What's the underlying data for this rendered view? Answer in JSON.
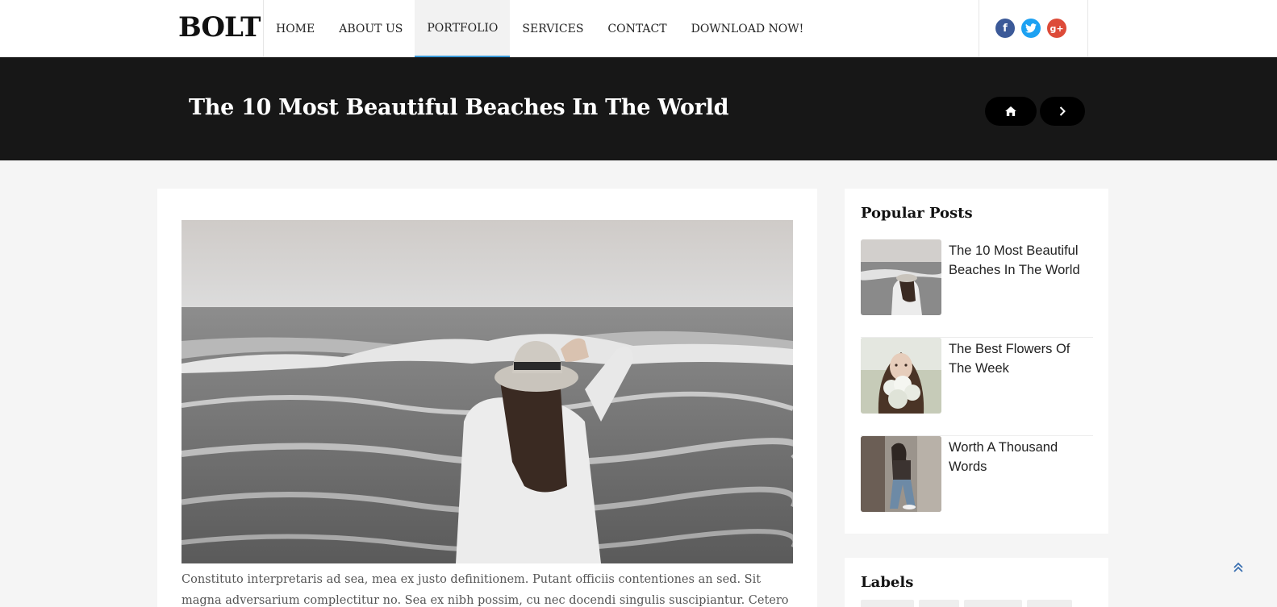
{
  "header": {
    "logo": "BOLT",
    "nav": [
      {
        "label": "HOME",
        "active": false
      },
      {
        "label": "ABOUT US",
        "active": false
      },
      {
        "label": "PORTFOLIO",
        "active": true
      },
      {
        "label": "SERVICES",
        "active": false
      },
      {
        "label": "CONTACT",
        "active": false
      },
      {
        "label": "DOWNLOAD NOW!",
        "active": false
      }
    ],
    "social": {
      "facebook_icon": "f",
      "twitter_icon": "twitter-bird",
      "google_plus_icon": "g+"
    }
  },
  "band": {
    "title": "The 10 Most Beautiful Beaches In The World",
    "home_icon": "home-icon",
    "next_icon": "chevron-right-icon"
  },
  "post": {
    "image": "woman-in-hat-at-sea-photo",
    "excerpt": "Constituto interpretaris ad sea, mea ex justo definitionem. Putant officiis contentiones an sed. Sit magna adversarium complectitur no. Sea ex nibh possim, cu nec docendi singulis suscipiantur. Cetero nostrud"
  },
  "sidebar": {
    "popular_title": "Popular Posts",
    "popular": [
      {
        "title": "The 10 Most Beautiful Beaches In The World"
      },
      {
        "title": "The Best Flowers Of The Week"
      },
      {
        "title": "Worth A Thousand Words"
      }
    ],
    "labels_title": "Labels"
  },
  "colors": {
    "accent": "#3a9ad9",
    "band": "#171717",
    "facebook": "#3b5998",
    "twitter": "#1da1f2",
    "google": "#dd4b39"
  }
}
